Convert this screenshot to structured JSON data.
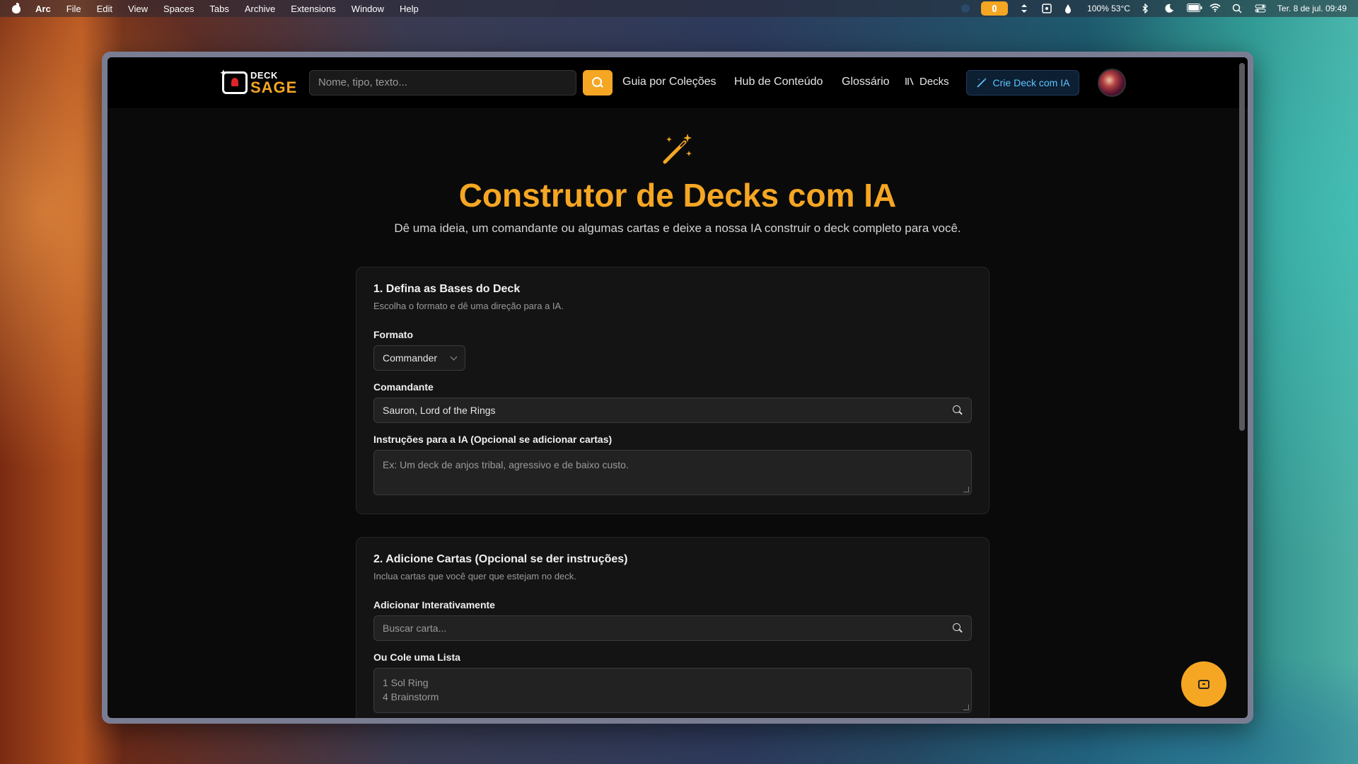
{
  "menubar": {
    "app": "Arc",
    "items": [
      "File",
      "Edit",
      "View",
      "Spaces",
      "Tabs",
      "Archive",
      "Extensions",
      "Window",
      "Help"
    ],
    "status": "100% 53°C",
    "datetime": "Ter. 8 de jul.  09:49"
  },
  "header": {
    "logo_top": "DECK",
    "logo_bottom": "SAGE",
    "search_placeholder": "Nome, tipo, texto...",
    "nav": [
      "Guia por Coleções",
      "Hub de Conteúdo",
      "Glossário"
    ],
    "decks_label": "Decks",
    "cta_label": "Crie Deck com IA"
  },
  "hero": {
    "title": "Construtor de Decks com IA",
    "subtitle": "Dê uma ideia, um comandante ou algumas cartas e deixe a nossa IA construir o deck completo para você."
  },
  "section1": {
    "title": "1. Defina as Bases do Deck",
    "description": "Escolha o formato e dê uma direção para a IA.",
    "format_label": "Formato",
    "format_value": "Commander",
    "commander_label": "Comandante",
    "commander_value": "Sauron, Lord of the Rings",
    "instructions_label": "Instruções para a IA (Opcional se adicionar cartas)",
    "instructions_placeholder": "Ex: Um deck de anjos tribal, agressivo e de baixo custo."
  },
  "section2": {
    "title": "2. Adicione Cartas (Opcional se der instruções)",
    "description": "Inclua cartas que você quer que estejam no deck.",
    "interactive_label": "Adicionar Interativamente",
    "search_placeholder": "Buscar carta...",
    "paste_label": "Ou Cole uma Lista",
    "paste_placeholder_line1": "1 Sol Ring",
    "paste_placeholder_line2": "4 Brainstorm"
  },
  "colors": {
    "accent": "#f5a623",
    "cta_text": "#5cc7ff",
    "background": "#0a0a0a"
  }
}
